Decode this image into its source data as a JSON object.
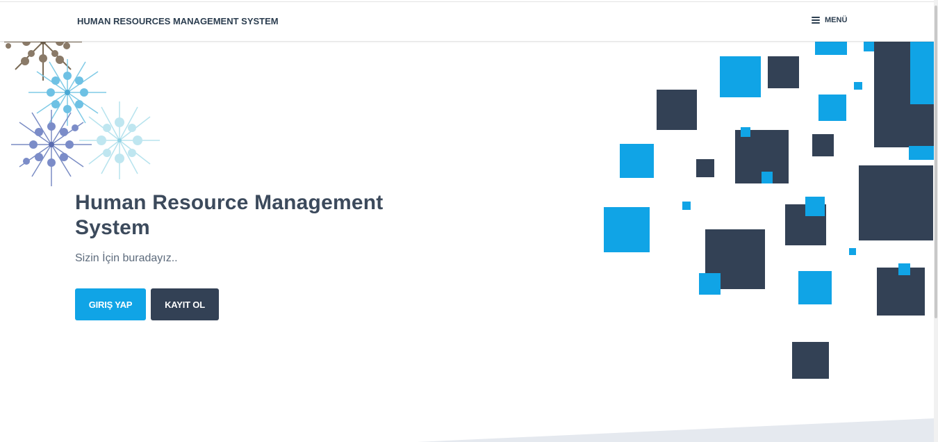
{
  "header": {
    "brand": "HUMAN RESOURCES MANAGEMENT SYSTEM",
    "menu_label": "MENÜ",
    "menu_icon": "hamburger-icon"
  },
  "hero": {
    "title": "Human Resource Management System",
    "subtitle": "Sizin İçin buradayız..",
    "login_label": "GIRIŞ YAP",
    "register_label": "KAYIT OL"
  },
  "colors": {
    "accent_blue": "#10a4e6",
    "dark_slate": "#334155",
    "text": "#3c4a5c"
  },
  "decorations": {
    "left": "snowflake-cluster",
    "right": "square-mosaic"
  }
}
